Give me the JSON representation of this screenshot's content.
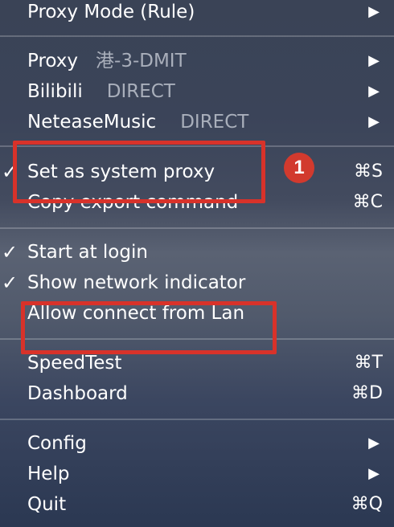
{
  "menu": {
    "proxy_mode": {
      "label": "Proxy Mode (Rule)",
      "arrow": "▶"
    },
    "proxy": {
      "label": "Proxy",
      "value": "港-3-DMIT",
      "arrow": "▶"
    },
    "bilibili": {
      "label": "Bilibili",
      "value": "DIRECT",
      "arrow": "▶"
    },
    "netease": {
      "label": "NeteaseMusic",
      "value": "DIRECT",
      "arrow": "▶"
    },
    "set_system_proxy": {
      "label": "Set as system proxy",
      "check": "✓",
      "shortcut": "⌘S"
    },
    "copy_export": {
      "label": "Copy export command",
      "shortcut": "⌘C"
    },
    "start_login": {
      "label": "Start at login",
      "check": "✓"
    },
    "show_indicator": {
      "label": "Show network indicator",
      "check": "✓"
    },
    "allow_lan": {
      "label": "Allow connect from Lan"
    },
    "speedtest": {
      "label": "SpeedTest",
      "shortcut": "⌘T"
    },
    "dashboard": {
      "label": "Dashboard",
      "shortcut": "⌘D"
    },
    "config": {
      "label": "Config",
      "arrow": "▶"
    },
    "help": {
      "label": "Help",
      "arrow": "▶"
    },
    "quit": {
      "label": "Quit",
      "shortcut": "⌘Q"
    }
  },
  "annotation": {
    "badge_number": "1",
    "highlight_color": "#d8322a"
  }
}
